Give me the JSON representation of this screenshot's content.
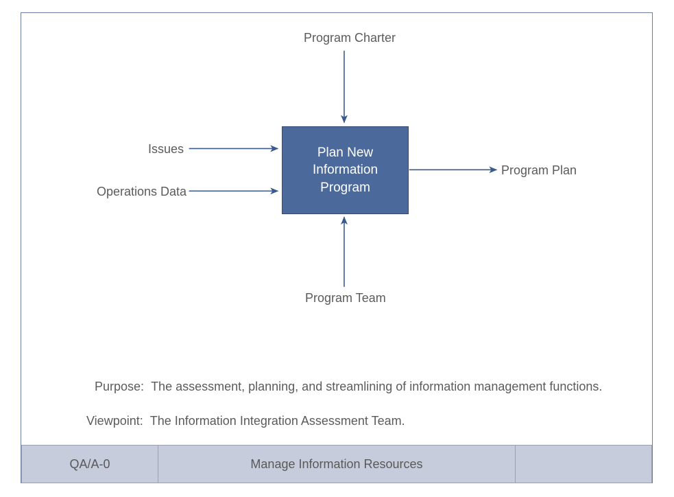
{
  "diagram": {
    "process_name": "Plan New\nInformation\nProgram",
    "control_label": "Program Charter",
    "input1_label": "Issues",
    "input2_label": "Operations Data",
    "mechanism_label": "Program Team",
    "output_label": "Program Plan",
    "purpose_label": "Purpose:",
    "purpose_text": "The assessment, planning, and streamlining of information management functions.",
    "viewpoint_label": "Viewpoint:",
    "viewpoint_text": "The Information Integration Assessment Team."
  },
  "footer": {
    "node": "QA/A-0",
    "title": "Manage Information Resources",
    "number": ""
  }
}
